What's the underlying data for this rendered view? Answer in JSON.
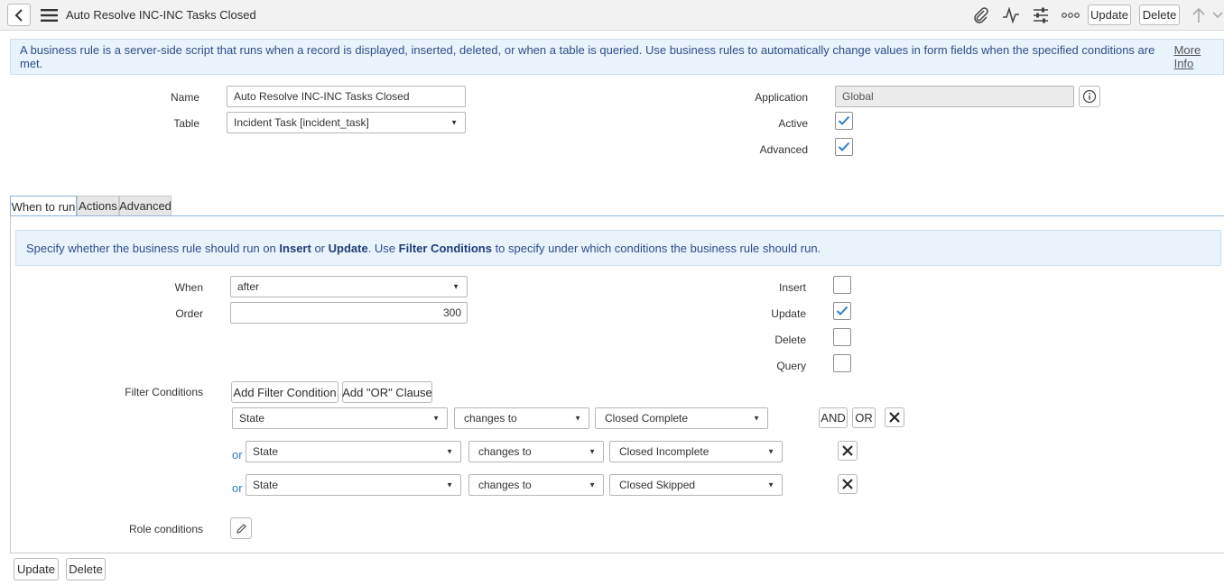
{
  "header": {
    "title": "Auto Resolve INC-INC Tasks Closed",
    "update_label": "Update",
    "delete_label": "Delete"
  },
  "info": {
    "text": "A business rule is a server-side script that runs when a record is displayed, inserted, deleted, or when a table is queried. Use business rules to automatically change values in form fields when the specified conditions are met.",
    "more_info": "More Info"
  },
  "form": {
    "name_label": "Name",
    "name_value": "Auto Resolve INC-INC Tasks Closed",
    "table_label": "Table",
    "table_value": "Incident Task [incident_task]",
    "application_label": "Application",
    "application_value": "Global",
    "active_label": "Active",
    "active_checked": true,
    "advanced_label": "Advanced",
    "advanced_checked": true
  },
  "tabs": [
    {
      "label": "When to run",
      "active": true
    },
    {
      "label": "Actions",
      "active": false
    },
    {
      "label": "Advanced",
      "active": false
    }
  ],
  "when_to_run": {
    "info_pre": "Specify whether the business rule should run on",
    "info_insert": "Insert",
    "info_or": "or",
    "info_update": "Update",
    "info_mid": ". Use",
    "info_filter": "Filter Conditions",
    "info_post": "to specify under which conditions the business rule should run.",
    "when_label": "When",
    "when_value": "after",
    "order_label": "Order",
    "order_value": "300",
    "insert_label": "Insert",
    "insert_checked": false,
    "update_label": "Update",
    "update_checked": true,
    "delete_label": "Delete",
    "delete_checked": false,
    "query_label": "Query",
    "query_checked": false,
    "filter_label": "Filter Conditions",
    "add_filter_label": "Add Filter Condition",
    "add_or_label": "Add \"OR\" Clause",
    "and_label": "AND",
    "or_button_label": "OR",
    "or_prefix": "or",
    "conditions": [
      {
        "field": "State",
        "operator": "changes to",
        "value": "Closed Complete"
      },
      {
        "field": "State",
        "operator": "changes to",
        "value": "Closed Incomplete"
      },
      {
        "field": "State",
        "operator": "changes to",
        "value": "Closed Skipped"
      }
    ],
    "role_label": "Role conditions"
  },
  "footer": {
    "update_label": "Update",
    "delete_label": "Delete"
  },
  "colors": {
    "check": "#2e7bcf",
    "info_bg": "#e9f3fb",
    "info_text": "#2d4e8a"
  }
}
